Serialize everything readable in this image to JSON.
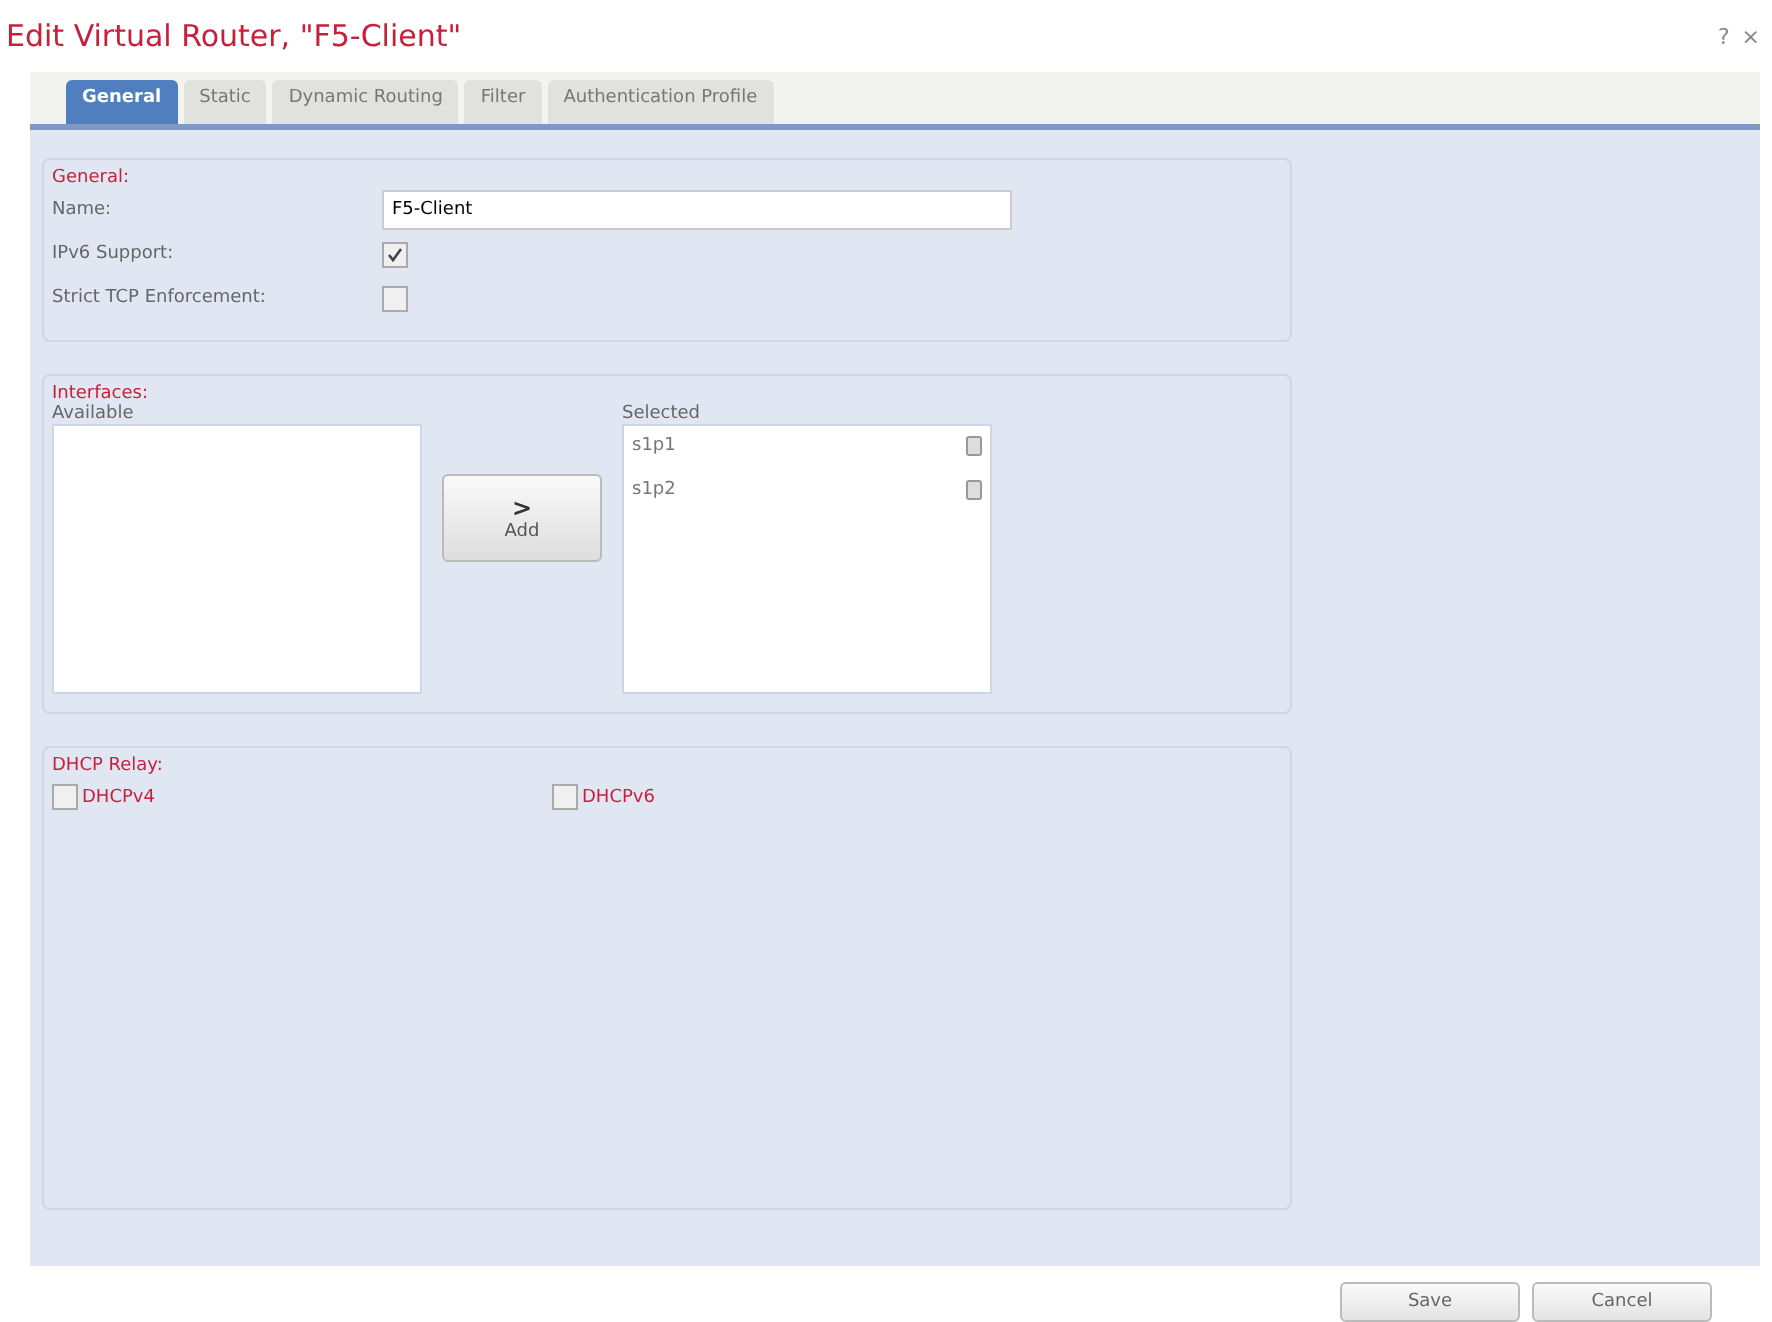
{
  "window": {
    "title": "Edit Virtual Router, \"F5-Client\"",
    "help": "?",
    "close": "×"
  },
  "tabs": [
    {
      "label": "General",
      "selected": true
    },
    {
      "label": "Static",
      "selected": false
    },
    {
      "label": "Dynamic Routing",
      "selected": false
    },
    {
      "label": "Filter",
      "selected": false
    },
    {
      "label": "Authentication Profile",
      "selected": false
    }
  ],
  "general": {
    "legend": "General:",
    "name_label": "Name:",
    "name_value": "F5-Client",
    "ipv6_label": "IPv6 Support:",
    "ipv6_checked": true,
    "strict_label": "Strict TCP Enforcement:",
    "strict_checked": false
  },
  "interfaces": {
    "legend": "Interfaces:",
    "available_label": "Available",
    "add_arrow": ">",
    "add_label": "Add",
    "selected_label": "Selected",
    "selected": [
      "s1p1",
      "s1p2"
    ]
  },
  "dhcp_relay": {
    "legend": "DHCP Relay:",
    "options": [
      {
        "label": "DHCPv4",
        "checked": false
      },
      {
        "label": "DHCPv6",
        "checked": false
      }
    ]
  },
  "buttons": [
    "Save",
    "Cancel"
  ]
}
